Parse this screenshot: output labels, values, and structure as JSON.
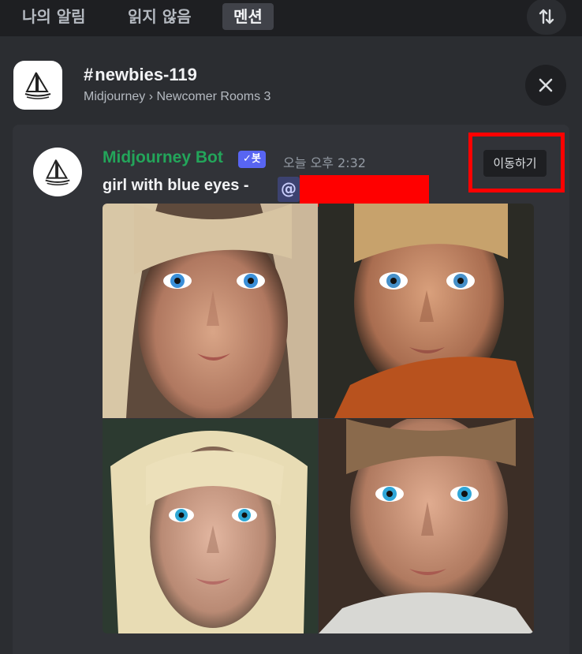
{
  "tabs": [
    "나의 알림",
    "읽지 않음",
    "멘션"
  ],
  "active_tab": "멘션",
  "icons": {
    "sort": "sort-arrows-icon",
    "channel_avatar": "sailboat-logo-icon",
    "close": "close-icon",
    "bot_check": "check-icon"
  },
  "channel": {
    "hash": "#",
    "name": "newbies-119",
    "breadcrumb": "Midjourney › Newcomer Rooms 3"
  },
  "message": {
    "author": "Midjourney Bot",
    "bot_badge": "✓봇",
    "timestamp": "오늘 오후 2:32",
    "jump_button": "이동하기",
    "content": "girl with blue eyes - ",
    "mention": "@"
  },
  "colors": {
    "author": "#23a55a",
    "badge": "#5865f2",
    "highlight": "#ff0000",
    "background": "#2b2d31",
    "card": "#313338"
  }
}
